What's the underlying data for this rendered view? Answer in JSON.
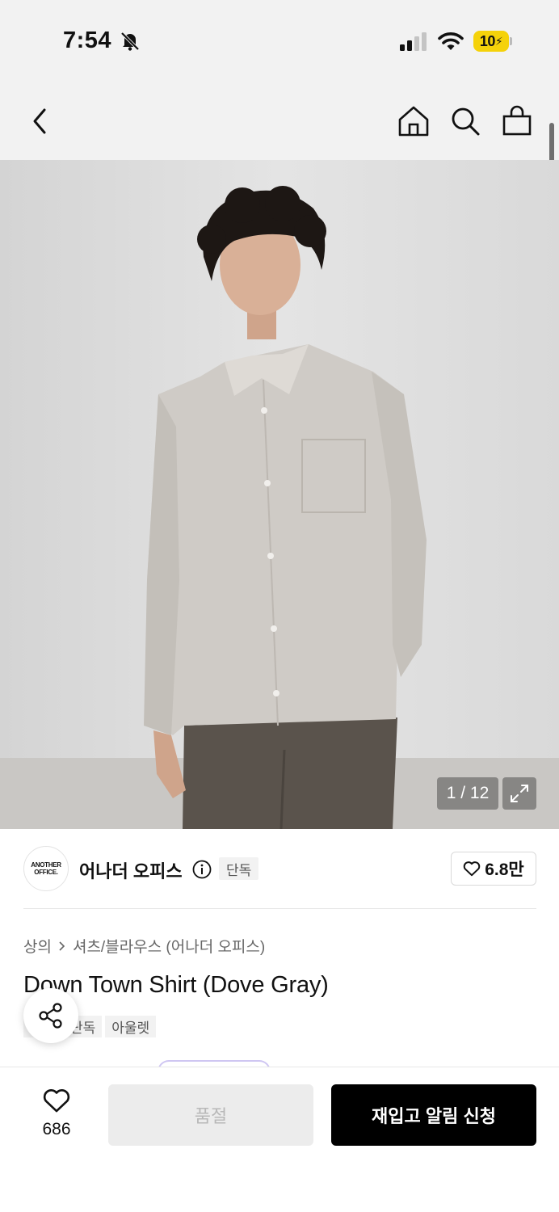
{
  "status_bar": {
    "time": "7:54",
    "battery": "10",
    "icons": [
      "bell-slash-icon",
      "signal-icon",
      "wifi-icon",
      "battery-charging-icon"
    ]
  },
  "header": {
    "icons": [
      "back-chevron-icon",
      "home-icon",
      "search-icon",
      "shopping-bag-icon"
    ]
  },
  "gallery": {
    "counter": "1 / 12"
  },
  "brand": {
    "logo_line1": "ANOTHER",
    "logo_line2": "OFFICE.",
    "name": "어나더 오피스",
    "badge": "단독",
    "likes": "6.8만"
  },
  "breadcrumb": {
    "items": [
      "상의",
      "셔츠/블라우스 (어나더 오피스)"
    ]
  },
  "product": {
    "title": "Down Town Shirt (Dove Gray)",
    "tags": [
      "단독",
      "아울렛"
    ]
  },
  "bottom_bar": {
    "like_count": "686",
    "soldout_label": "품절",
    "restock_label": "재입고 알림 신청"
  },
  "colors": {
    "accent": "#000000",
    "badge_bg": "#f2f2f2",
    "battery": "#f5d20a"
  }
}
